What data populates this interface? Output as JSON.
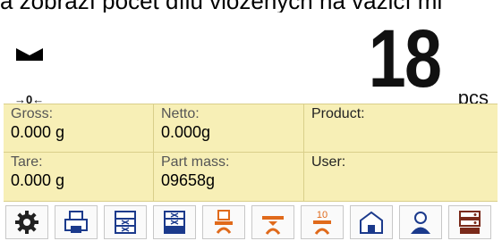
{
  "caption": "a zobrazí počet dílů vložených na vážicí mi",
  "display": {
    "value": "18",
    "unit": "pcs",
    "zero_indicator": "→0←"
  },
  "info": {
    "gross_label": "Gross:",
    "gross_value": "0.000 g",
    "netto_label": "Netto:",
    "netto_value": "0.000g",
    "product_label": "Product:",
    "product_value": "",
    "tare_label": "Tare:",
    "tare_value": "0.000 g",
    "partmass_label": "Part mass:",
    "partmass_value": "09658g",
    "user_label": "User:",
    "user_value": ""
  },
  "toolbar": {
    "icons": [
      "gear-icon",
      "printer-icon",
      "database-icon",
      "database-icon-2",
      "scale-print-icon",
      "scale-tare-icon",
      "scale-10-icon",
      "warehouse-icon",
      "user-icon",
      "server-icon"
    ],
    "scale_10_text": "10",
    "accent": "#e06a1b"
  }
}
